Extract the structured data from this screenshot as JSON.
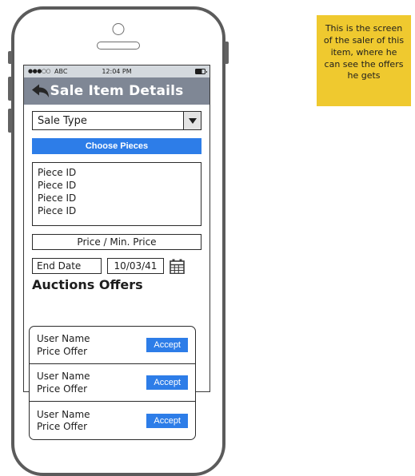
{
  "status_bar": {
    "signal_dots": "●●●○○",
    "carrier": "ABC",
    "time": "12:04 PM",
    "battery_icon": "battery-icon"
  },
  "header": {
    "back_icon": "back-arrow-icon",
    "title": "Sale Item Details"
  },
  "form": {
    "sale_type": {
      "value": "Sale Type",
      "arrow_icon": "chevron-down-icon"
    },
    "choose_pieces_label": "Choose Pieces",
    "pieces": [
      "Piece ID",
      "Piece ID",
      "Piece ID",
      "Piece ID"
    ],
    "price_field": "Price / Min. Price",
    "end_date_label": "End Date",
    "end_date_value": "10/03/41",
    "calendar_icon": "calendar-icon"
  },
  "offers_section": {
    "heading": "Auctions Offers",
    "offers": [
      {
        "user": "User Name",
        "price": "Price Offer",
        "accept_label": "Accept"
      },
      {
        "user": "User Name",
        "price": "Price Offer",
        "accept_label": "Accept"
      },
      {
        "user": "User Name",
        "price": "Price Offer",
        "accept_label": "Accept"
      }
    ]
  },
  "annotation": {
    "text": "This is the screen of the saler of this item, where he can see the offers he gets"
  },
  "colors": {
    "accent_blue": "#2d7de8",
    "header_gray": "#7f8795",
    "status_gray": "#d4d9de",
    "note_yellow": "#efc92f",
    "frame_gray": "#5b5b5b"
  }
}
